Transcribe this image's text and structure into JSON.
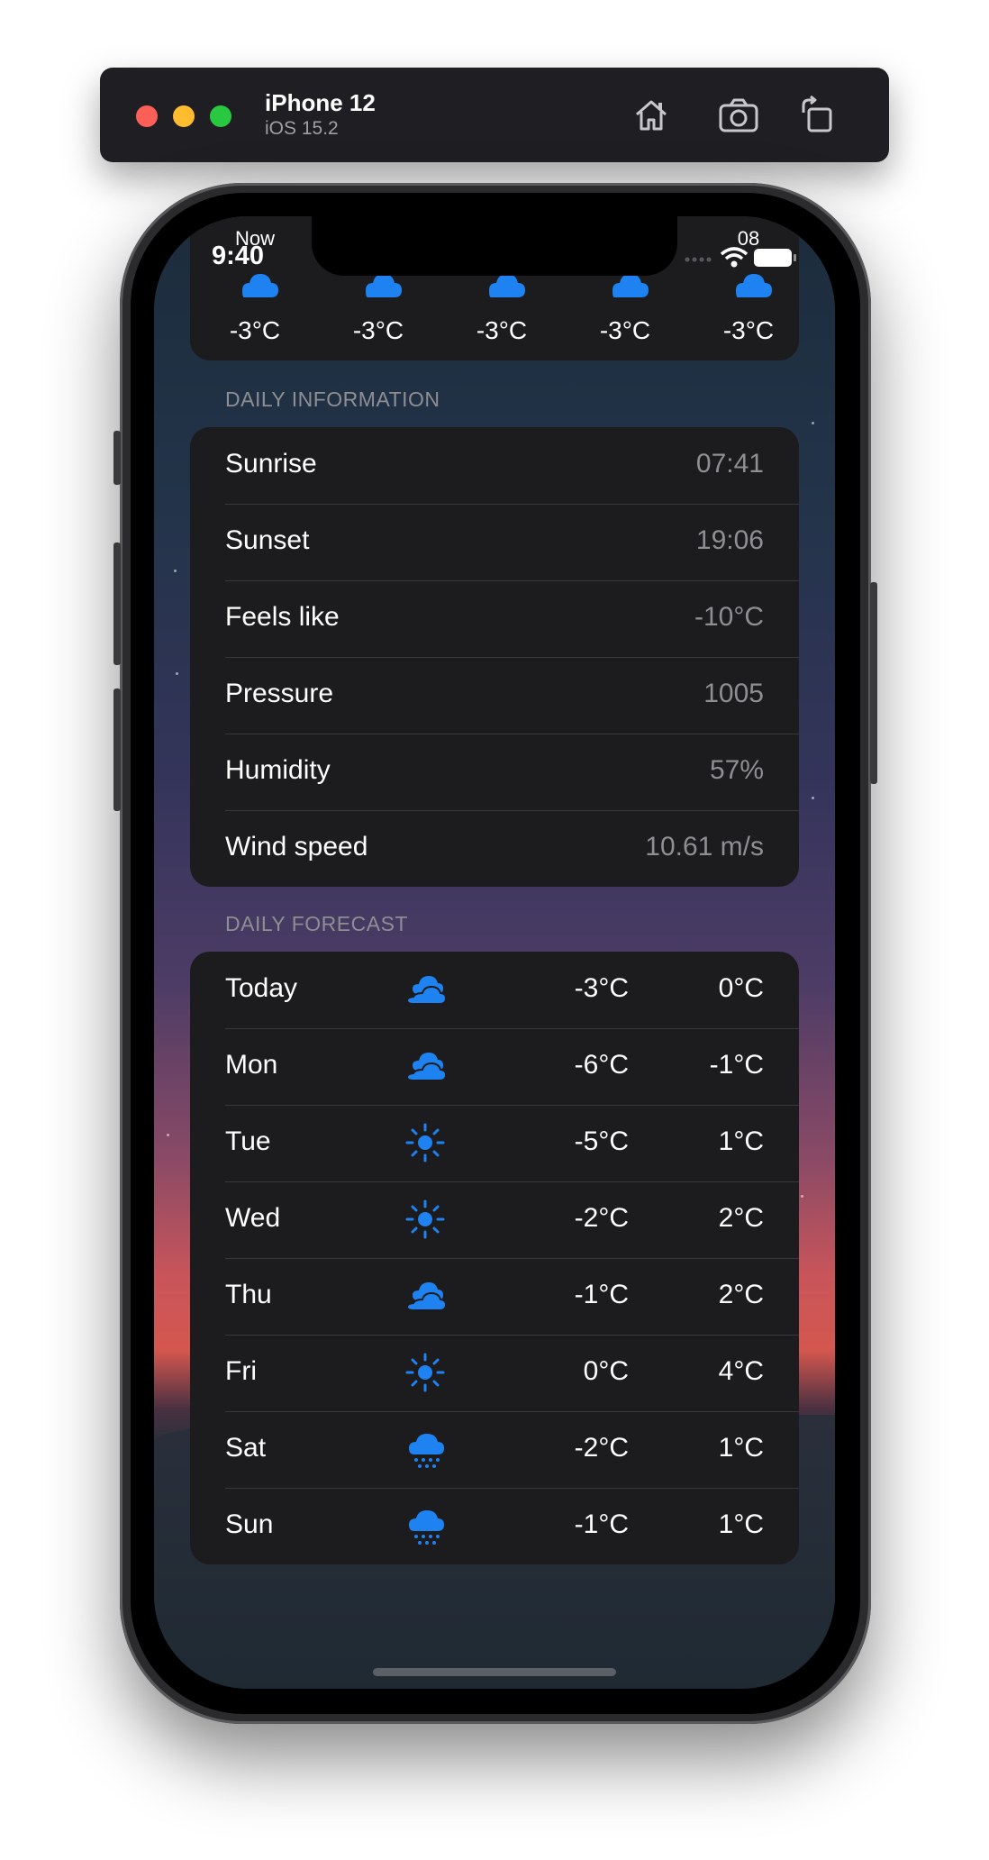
{
  "simulator": {
    "device_name": "iPhone 12",
    "os_version": "iOS 15.2",
    "buttons": [
      "home-icon",
      "screenshot-icon",
      "rotate-icon"
    ]
  },
  "status_bar": {
    "time": "9:40"
  },
  "hourly": [
    {
      "label": "Now",
      "temp": "-3°C",
      "icon": "cloud-icon"
    },
    {
      "label": "",
      "temp": "-3°C",
      "icon": "cloud-icon"
    },
    {
      "label": "",
      "temp": "-3°C",
      "icon": "cloud-icon"
    },
    {
      "label": "",
      "temp": "-3°C",
      "icon": "cloud-icon"
    },
    {
      "label": "08",
      "temp": "-3°C",
      "icon": "cloud-icon"
    }
  ],
  "daily_information": {
    "title": "DAILY INFORMATION",
    "rows": [
      {
        "label": "Sunrise",
        "value": "07:41"
      },
      {
        "label": "Sunset",
        "value": "19:06"
      },
      {
        "label": "Feels like",
        "value": "-10°C"
      },
      {
        "label": "Pressure",
        "value": "1005"
      },
      {
        "label": "Humidity",
        "value": "57%"
      },
      {
        "label": "Wind speed",
        "value": "10.61 m/s"
      }
    ]
  },
  "daily_forecast": {
    "title": "DAILY FORECAST",
    "days": [
      {
        "day": "Today",
        "icon": "clouds-icon",
        "low": "-3°C",
        "high": "0°C"
      },
      {
        "day": "Mon",
        "icon": "clouds-icon",
        "low": "-6°C",
        "high": "-1°C"
      },
      {
        "day": "Tue",
        "icon": "sun-icon",
        "low": "-5°C",
        "high": "1°C"
      },
      {
        "day": "Wed",
        "icon": "sun-icon",
        "low": "-2°C",
        "high": "2°C"
      },
      {
        "day": "Thu",
        "icon": "clouds-icon",
        "low": "-1°C",
        "high": "2°C"
      },
      {
        "day": "Fri",
        "icon": "sun-icon",
        "low": "0°C",
        "high": "4°C"
      },
      {
        "day": "Sat",
        "icon": "snow-cloud-icon",
        "low": "-2°C",
        "high": "1°C"
      },
      {
        "day": "Sun",
        "icon": "snow-cloud-icon",
        "low": "-1°C",
        "high": "1°C"
      }
    ]
  },
  "colors": {
    "accent": "#1e82f0",
    "card_bg": "#1c1c1e",
    "secondary_text": "#8e8e93"
  }
}
